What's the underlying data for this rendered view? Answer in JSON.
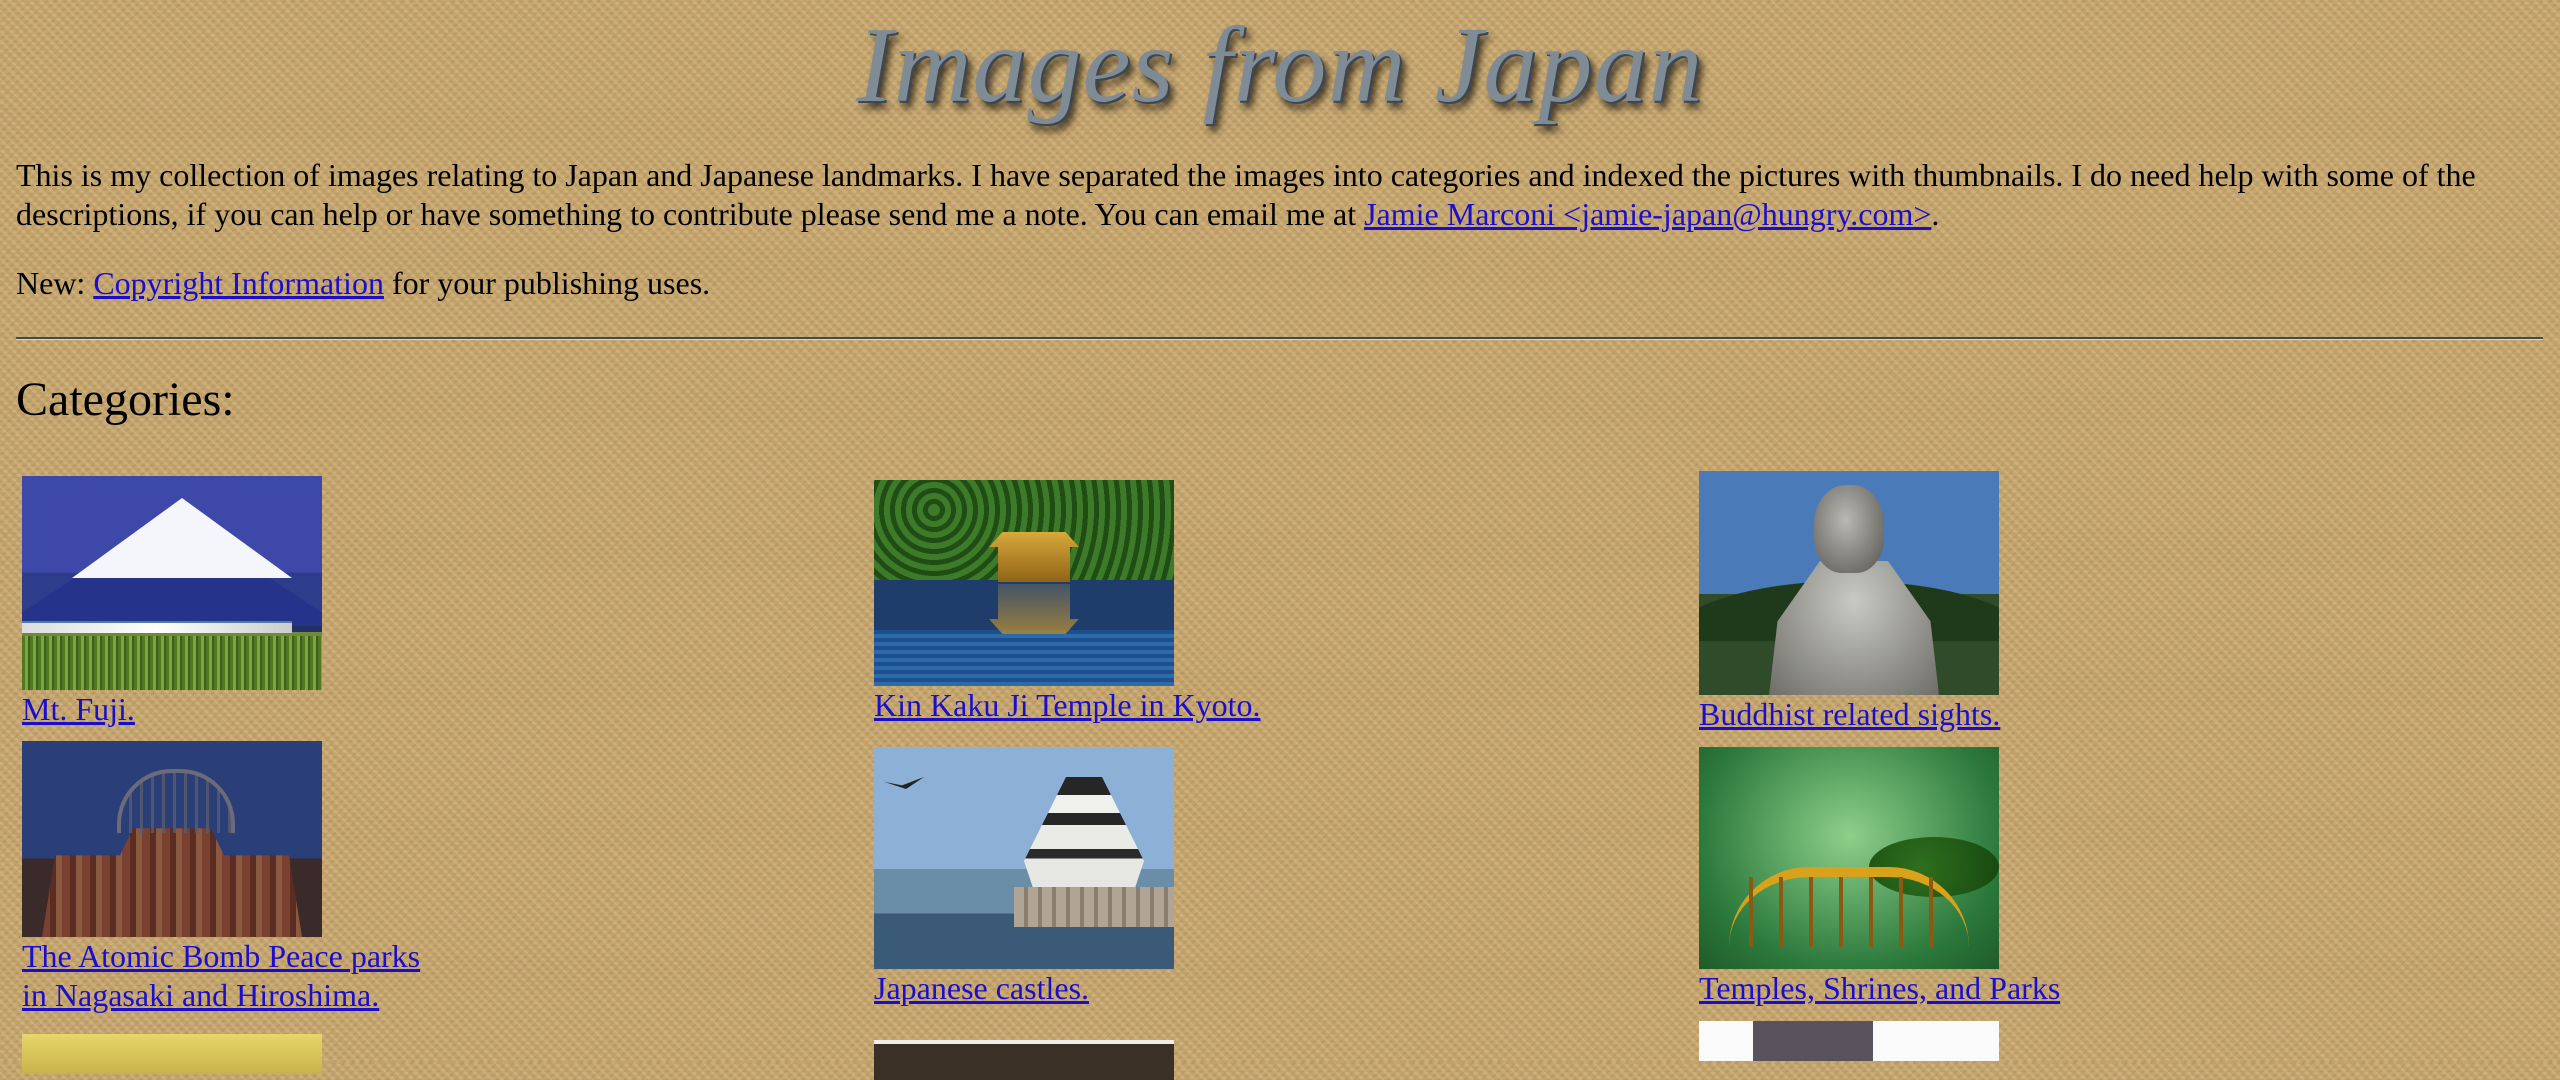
{
  "page": {
    "title": "Images from Japan",
    "intro_text": "This is my collection of images relating to Japan and Japanese landmarks. I have separated the images into categories and indexed the pictures with thumbnails. I do need help with some of the descriptions, if you can help or have something to contribute please send me a note. You can email me at ",
    "email_link": "Jamie Marconi <jamie-japan@hungry.com>",
    "intro_end": ".",
    "new_prefix": "New: ",
    "copyright_link": "Copyright Information",
    "new_suffix": " for your publishing uses.",
    "categories_heading": "Categories:"
  },
  "categories": [
    {
      "caption": "Mt. Fuji.",
      "icon": "mt-fuji-thumbnail"
    },
    {
      "caption": "Kin Kaku Ji Temple in Kyoto.",
      "icon": "kinkakuji-thumbnail"
    },
    {
      "caption": "Buddhist related sights.",
      "icon": "buddha-thumbnail"
    },
    {
      "caption_line1": "The Atomic Bomb Peace parks",
      "caption_line2": "in Nagasaki and Hiroshima.",
      "icon": "atomic-dome-thumbnail"
    },
    {
      "caption": "Japanese castles.",
      "icon": "castle-thumbnail"
    },
    {
      "caption": "Temples, Shrines, and Parks",
      "icon": "garden-bridge-thumbnail"
    }
  ],
  "colors": {
    "background": "#c7a56a",
    "link": "#1a0dcc",
    "title": "#7f8b95",
    "rule": "#3c4a5a"
  }
}
